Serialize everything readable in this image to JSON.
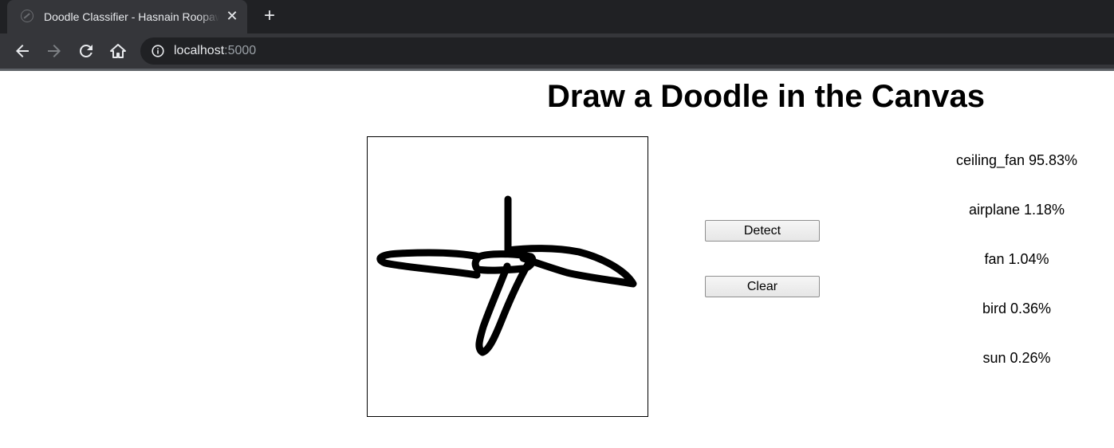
{
  "browser": {
    "tab_title": "Doodle Classifier - Hasnain Roopawalla",
    "tab_close_glyph": "✕",
    "new_tab_glyph": "+",
    "url_host": "localhost",
    "url_port": ":5000",
    "icons": [
      "globe-favicon-icon",
      "back-icon",
      "forward-icon",
      "reload-icon",
      "home-icon",
      "info-icon",
      "close-icon",
      "plus-icon"
    ]
  },
  "page": {
    "heading": "Draw a Doodle in the Canvas",
    "buttons": {
      "detect": "Detect",
      "clear": "Clear"
    },
    "predictions": [
      "ceiling_fan 95.83%",
      "airplane 1.18%",
      "fan 1.04%",
      "bird 0.36%",
      "sun 0.26%"
    ],
    "canvas": {
      "stroke_color": "#000000",
      "background": "#ffffff"
    }
  }
}
